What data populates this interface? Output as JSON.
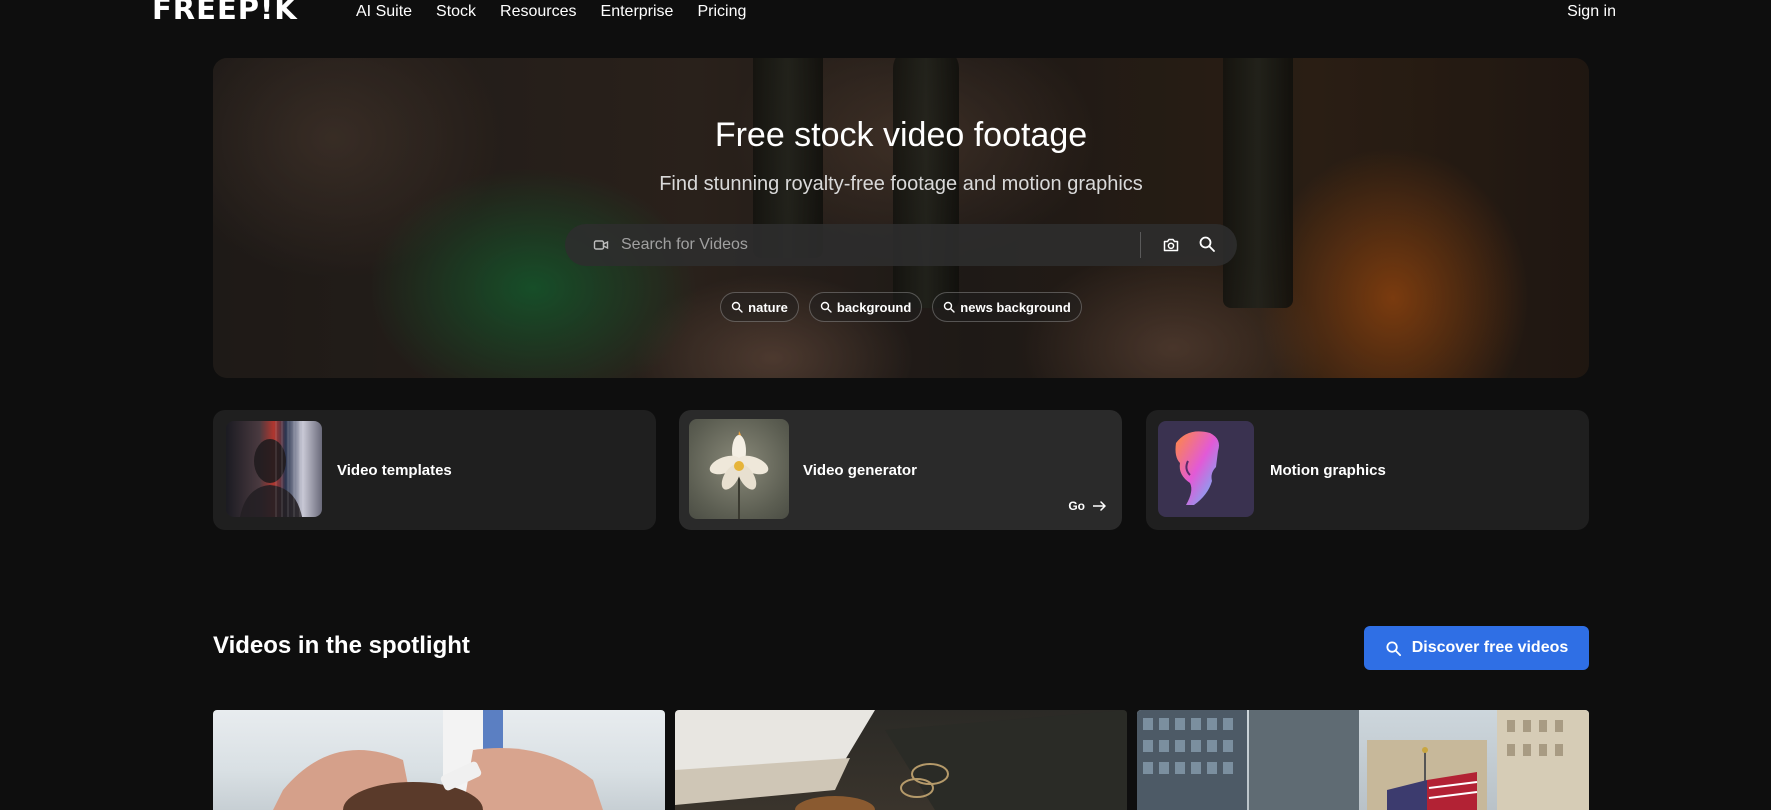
{
  "nav": {
    "logo": "FREEP!K",
    "links": [
      "AI Suite",
      "Stock",
      "Resources",
      "Enterprise",
      "Pricing"
    ],
    "sign_in": "Sign in"
  },
  "hero": {
    "title": "Free stock video footage",
    "subtitle": "Find stunning royalty-free footage and motion graphics",
    "search": {
      "placeholder": "Search for Videos",
      "value": "",
      "leading_icon": "video-camera-icon",
      "camera_icon": "camera-icon",
      "search_icon": "search-icon"
    },
    "suggestions": [
      "nature",
      "background",
      "news background"
    ]
  },
  "cards": [
    {
      "title": "Video templates",
      "thumb": "portrait-glitch"
    },
    {
      "title": "Video generator",
      "thumb": "white-flower",
      "action": "Go"
    },
    {
      "title": "Motion graphics",
      "thumb": "colorful-profile"
    }
  ],
  "spotlight": {
    "title": "Videos in the spotlight",
    "button": "Discover free videos",
    "thumbnails": [
      "doctor-hands",
      "desk-glasses",
      "city-flag"
    ]
  },
  "colors": {
    "background": "#0e0e0e",
    "card": "#1f1f1f",
    "accent": "#2f6fe5"
  }
}
